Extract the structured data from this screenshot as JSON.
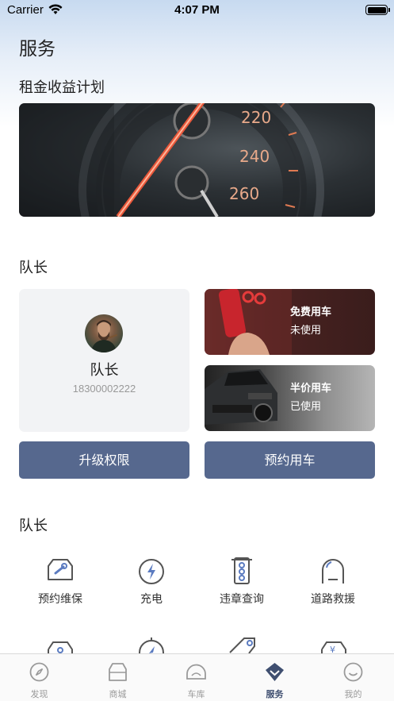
{
  "status_bar": {
    "carrier": "Carrier",
    "time": "4:07 PM"
  },
  "page_title": "服务",
  "rent_section": {
    "title": "租金收益计划",
    "gauge_numbers": [
      "220",
      "240",
      "260"
    ]
  },
  "member_section": {
    "title": "队长",
    "name": "队长",
    "phone": "18300002222",
    "perks": [
      {
        "title": "免费用车",
        "status": "未使用"
      },
      {
        "title": "半价用车",
        "status": "已使用"
      }
    ],
    "buttons": {
      "upgrade": "升级权限",
      "reserve": "预约用车"
    }
  },
  "services_section": {
    "title": "队长",
    "items": [
      {
        "label": "预约维保",
        "icon": "car-wrench-icon"
      },
      {
        "label": "充电",
        "icon": "charging-bolt-icon"
      },
      {
        "label": "违章查询",
        "icon": "traffic-light-icon"
      },
      {
        "label": "道路救援",
        "icon": "road-rescue-icon"
      }
    ],
    "row2_icons": [
      "car-icon",
      "compass-icon",
      "tag-icon",
      "car-yen-icon"
    ],
    "accent_color": "#56688e"
  },
  "tabbar": {
    "tabs": [
      {
        "label": "发现",
        "icon": "compass-icon"
      },
      {
        "label": "商城",
        "icon": "shop-icon"
      },
      {
        "label": "车库",
        "icon": "garage-icon"
      },
      {
        "label": "服务",
        "icon": "service-icon",
        "active": true
      },
      {
        "label": "我的",
        "icon": "smile-icon"
      }
    ],
    "active_color": "#3f4f70",
    "inactive_color": "#9a9a9a"
  }
}
